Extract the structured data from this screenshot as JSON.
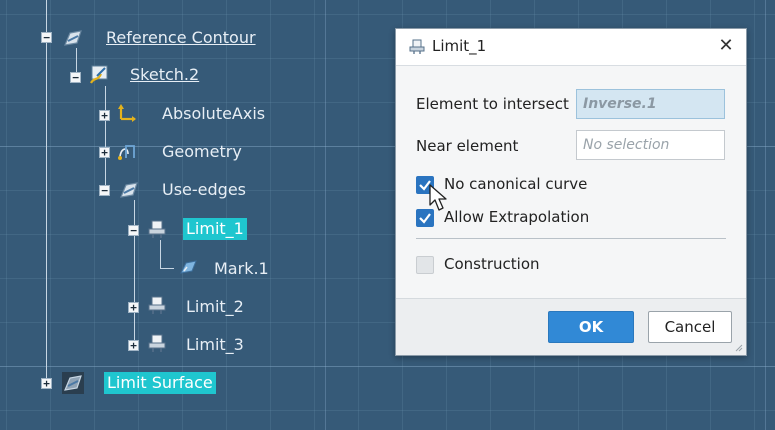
{
  "tree": {
    "items": [
      {
        "label": "Reference Contour",
        "expander": "−",
        "icon": "surface-icon"
      },
      {
        "label": "Sketch.2",
        "expander": "−",
        "icon": "sketch-icon"
      },
      {
        "label": "AbsoluteAxis",
        "expander": "+",
        "icon": "axis-icon"
      },
      {
        "label": "Geometry",
        "expander": "+",
        "icon": "geometry-icon"
      },
      {
        "label": "Use-edges",
        "expander": "−",
        "icon": "use-edges-icon"
      },
      {
        "label": "Limit_1",
        "expander": "−",
        "icon": "limit-icon"
      },
      {
        "label": "Mark.1",
        "icon": "mark-icon"
      },
      {
        "label": "Limit_2",
        "expander": "+",
        "icon": "limit-icon"
      },
      {
        "label": "Limit_3",
        "expander": "+",
        "icon": "limit-icon"
      },
      {
        "label": "Limit Surface",
        "expander": "+",
        "icon": "surface-icon"
      }
    ]
  },
  "dialog": {
    "title": "Limit_1",
    "close_glyph": "✕",
    "element_to_intersect_label": "Element to intersect",
    "element_to_intersect_value": "Inverse.1",
    "near_element_label": "Near element",
    "near_element_value": "No selection",
    "no_canonical_label": "No canonical curve",
    "no_canonical_checked": true,
    "allow_extrapolation_label": "Allow Extrapolation",
    "allow_extrapolation_checked": true,
    "construction_label": "Construction",
    "construction_checked": false,
    "ok_label": "OK",
    "cancel_label": "Cancel"
  },
  "colors": {
    "background": "#365a78",
    "selection": "#1fc6cf",
    "ok_button": "#3189d6",
    "checkbox_on": "#2a74c0"
  }
}
